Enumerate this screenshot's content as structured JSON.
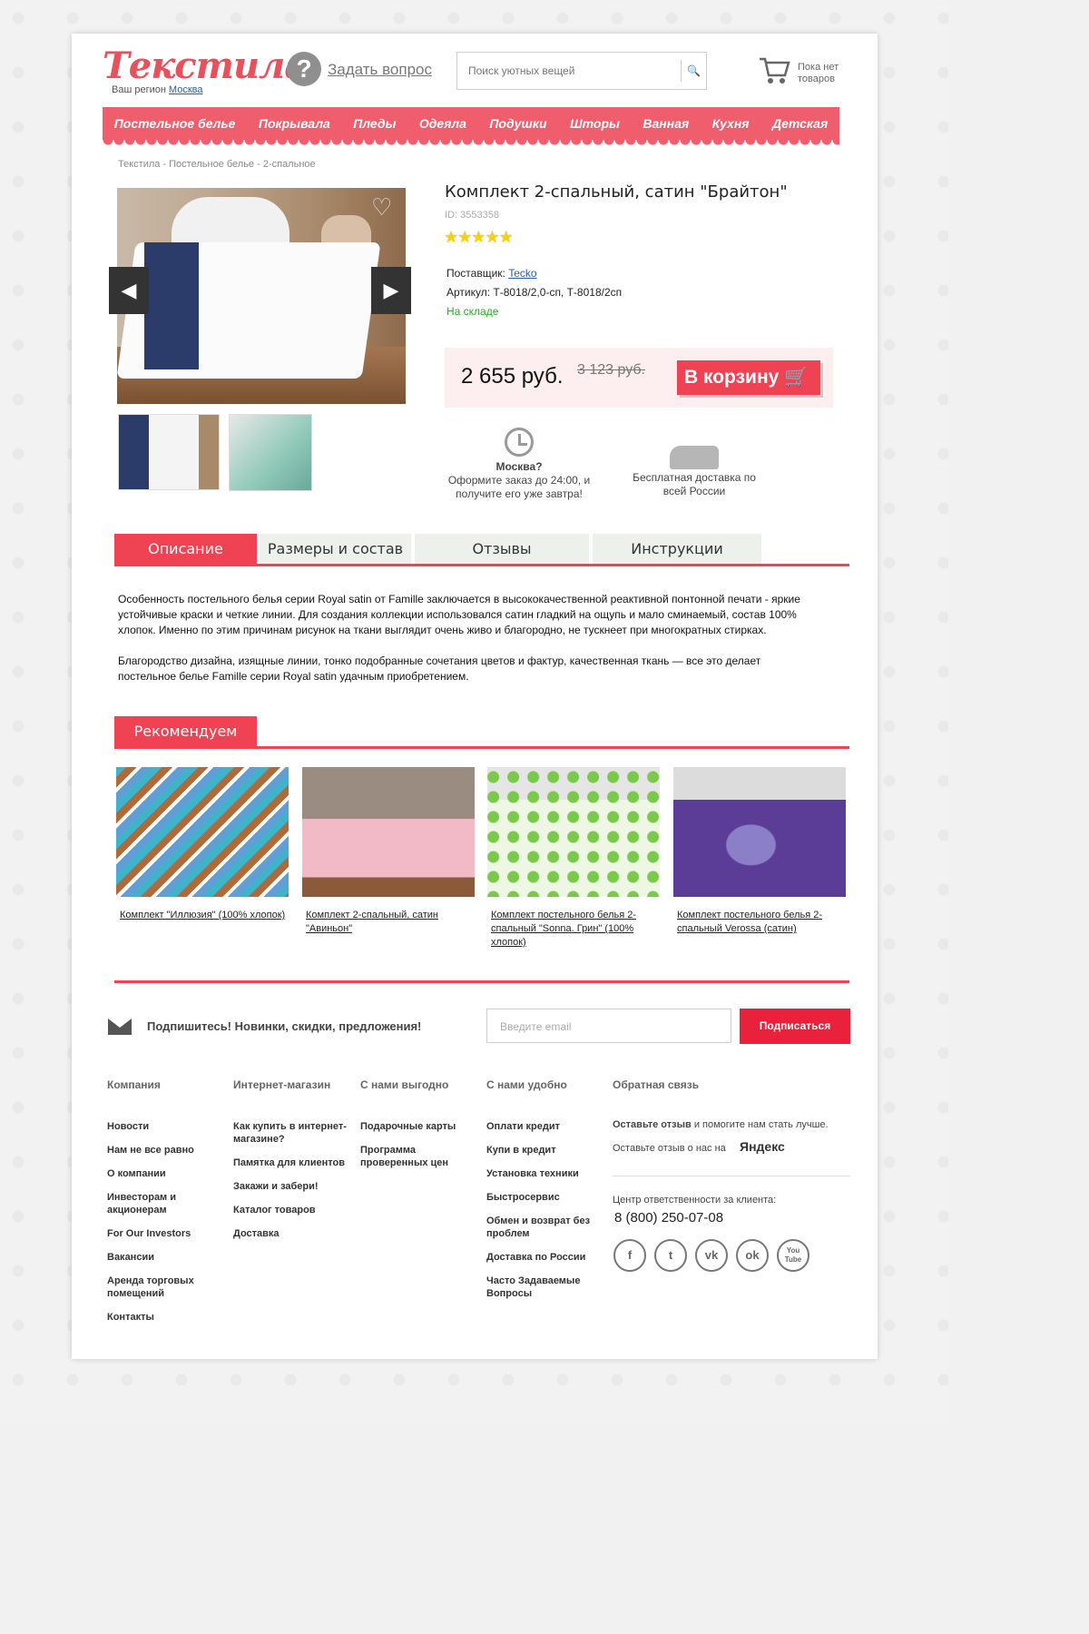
{
  "header": {
    "logo": "Текстила",
    "region_label": "Ваш регион",
    "region_value": "Москва",
    "ask": "Задать вопрос",
    "search_placeholder": "Поиск уютных вещей",
    "cart_text": "Пока нет товаров"
  },
  "nav": [
    "Постельное белье",
    "Покрывала",
    "Пледы",
    "Одеяла",
    "Подушки",
    "Шторы",
    "Ванная",
    "Кухня",
    "Детская"
  ],
  "breadcrumb": "Текстила - Постельное белье - 2-спальное",
  "product": {
    "title": "Комплект 2-спальный, сатин \"Брайтон\"",
    "id": "ID: 3553358",
    "rating": 5,
    "stars": "★★★★★",
    "supplier_label": "Поставщик:",
    "supplier": "Tecko",
    "article": "Артикул: Т-8018/2,0-сп, Т-8018/2сп",
    "stock": "На складе",
    "price": "2 655 руб.",
    "old_price": "3 123 руб.",
    "buy": "В корзину"
  },
  "delivery": {
    "moscow_title": "Москва?",
    "moscow_text": "Оформите заказ до 24:00, и получите его уже завтра!",
    "free": "Бесплатная доставка по всей России"
  },
  "tabs": [
    "Описание",
    "Размеры и состав",
    "Отзывы",
    "Инструкции"
  ],
  "description": [
    "Особенность постельного белья серии Royal satin от Famille заключается в высококачественной реактивной понтонной печати - яркие устойчивые краски и четкие линии. Для создания коллекции использовался сатин гладкий на ощупь и мало сминаемый, состав 100% хлопок. Именно по этим причинам рисунок на ткани выглядит очень живо и благородно, не тускнеет при многократных стирках.",
    "Благородство дизайна, изящные линии, тонко подобранные сочетания цветов и фактур, качественная ткань — все это делает постельное белье Famille серии Royal satin удачным приобретением."
  ],
  "recommend": {
    "title": "Рекомендуем",
    "items": [
      "Комплект \"Иллюзия\" (100% хлопок)",
      "Комплект 2-спальный, сатин \"Авиньон\"",
      "Комплект постельного белья 2-спальный \"Sonna. Грин\" (100% хлопок)",
      "Комплект постельного белья 2-спальный Verossa (сатин)"
    ]
  },
  "subscribe": {
    "text": "Подпишитесь! Новинки, скидки, предложения!",
    "placeholder": "Введите email",
    "button": "Подписаться"
  },
  "footer": {
    "col1": {
      "title": "Компания",
      "links": [
        "Новости",
        "Нам не все равно",
        "О компании",
        "Инвесторам и акционерам",
        "For Our Investors",
        "Вакансии",
        "Аренда торговых помещений",
        "Контакты"
      ]
    },
    "col2": {
      "title": "Интернет-магазин",
      "links": [
        "Как купить в интернет-магазине?",
        "Памятка для клиентов",
        "Закажи и забери!",
        "Каталог товаров",
        "Доставка"
      ]
    },
    "col3": {
      "title": "С нами выгодно",
      "links": [
        "Подарочные карты",
        "Программа проверенных цен"
      ]
    },
    "col4": {
      "title": "С нами удобно",
      "links": [
        "Оплати кредит",
        "Купи в кредит",
        "Установка техники",
        "Быстросервис",
        "Обмен и возврат без проблем",
        "Доставка по России",
        "Часто Задаваемые Вопросы"
      ]
    },
    "col5": {
      "title": "Обратная связь",
      "leave_bold": "Оставьте отзыв",
      "leave_rest": "и помогите нам стать лучше.",
      "leave2": "Оставьте отзыв о нас на",
      "yandex": "Яндекс",
      "center": "Центр ответственности за клиента:",
      "phone": "8 (800) 250-07-08"
    },
    "social": [
      "f",
      "t",
      "vk",
      "ok",
      "You Tube"
    ]
  },
  "colors": {
    "accent": "#ef4353",
    "nav": "#f05d6c",
    "stock": "#1cb51c"
  }
}
